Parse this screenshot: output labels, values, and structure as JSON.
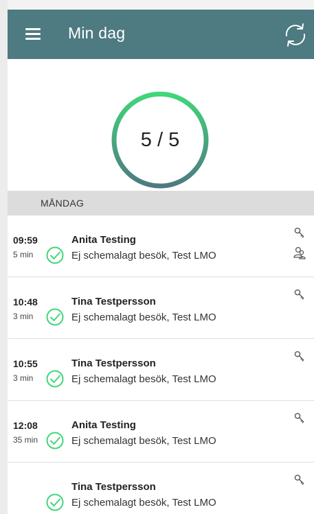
{
  "appbar": {
    "title": "Min dag",
    "menu_icon": "hamburger-menu-icon",
    "sync_icon": "sync-icon",
    "color": "#4e7a81"
  },
  "progress": {
    "label": "5 / 5",
    "completed": 5,
    "total": 5,
    "ring_gradient": [
      "#41d67a",
      "#4e7a81"
    ]
  },
  "day": {
    "label": "MÅNDAG"
  },
  "visits": [
    {
      "time": "09:59",
      "duration": "5 min",
      "name": "Anita Testing",
      "description": "Ej schemalagt besök, Test LMO",
      "status_icon": "check-circle-icon",
      "icons": [
        "key-icon",
        "person-group-icon"
      ]
    },
    {
      "time": "10:48",
      "duration": "3 min",
      "name": "Tina Testpersson",
      "description": "Ej schemalagt besök, Test LMO",
      "status_icon": "check-circle-icon",
      "icons": [
        "key-icon"
      ]
    },
    {
      "time": "10:55",
      "duration": "3 min",
      "name": "Tina Testpersson",
      "description": "Ej schemalagt besök, Test LMO",
      "status_icon": "check-circle-icon",
      "icons": [
        "key-icon"
      ]
    },
    {
      "time": "12:08",
      "duration": "35 min",
      "name": "Anita Testing",
      "description": "Ej schemalagt besök, Test LMO",
      "status_icon": "check-circle-icon",
      "icons": [
        "key-icon"
      ]
    },
    {
      "time": "",
      "duration": "",
      "name": "Tina Testpersson",
      "description": "Ej schemalagt besök, Test LMO",
      "status_icon": "check-circle-icon",
      "icons": [
        "key-icon"
      ]
    }
  ],
  "colors": {
    "accent_green": "#41d67a",
    "day_header_bg": "#dcdcdc"
  }
}
